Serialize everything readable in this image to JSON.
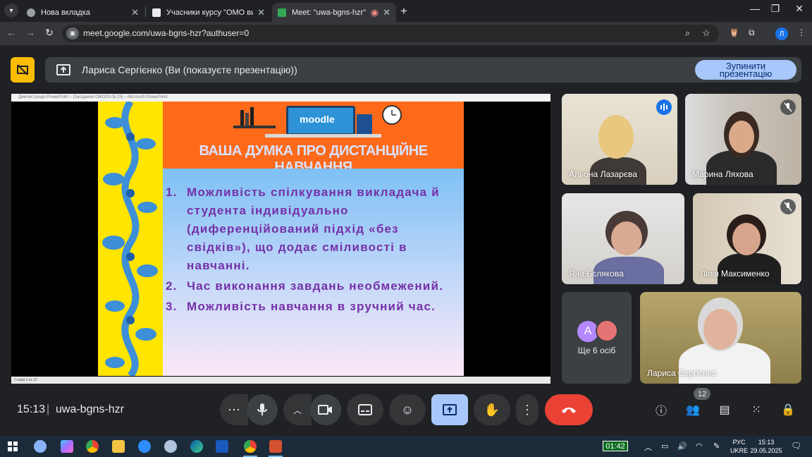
{
  "browser": {
    "tabs": [
      {
        "title": "Нова вкладка",
        "active": false
      },
      {
        "title": "Учасники курсу \"ОМО виклад",
        "active": false
      },
      {
        "title": "Meet: \"uwa-bgns-hzr\"",
        "active": true
      }
    ],
    "url": "meet.google.com/uwa-bgns-hzr?authuser=0",
    "profile_initial": "Л"
  },
  "banner": {
    "text": "Лариса Сергієнко (Ви (показуєте презентацію))",
    "stop_button": [
      "Зупинити",
      "презентацію"
    ]
  },
  "presentation": {
    "window_title": "Демонстрація PowerPoint – [Засідання ОМО29.05.25] – Microsoft PowerPoint",
    "status": "Слайд 3 из 12",
    "logo_text": "moodle",
    "heading": "ВАША ДУМКА ПРО ДИСТАНЦІЙНЕ НАВЧАННЯ",
    "items": [
      {
        "num": "1.",
        "text": "Можливість спілкування викладача й студента індивідуально (диференційований підхід «без свідків»), що додає сміливості в навчанні."
      },
      {
        "num": "2.",
        "text": "Час виконання завдань необмежений."
      },
      {
        "num": "3.",
        "text": "Можливість навчання в зручний час."
      }
    ]
  },
  "participants": [
    {
      "name": "Альона Лазарєва",
      "status": "speaking"
    },
    {
      "name": "Марина Ляхова",
      "status": "muted"
    },
    {
      "name": "Яна Бєлякова",
      "status": ""
    },
    {
      "name": "Лілія Максименко",
      "status": "muted"
    },
    {
      "name": "Лариса Сергієнко",
      "status": ""
    }
  ],
  "others": {
    "avatar_initial": "A",
    "label": "Ще 6 осіб"
  },
  "bottom_bar": {
    "time": "15:13",
    "separator": "|",
    "meeting_code": "uwa-bgns-hzr",
    "participant_count": "12"
  },
  "taskbar": {
    "timer": "01:42",
    "language_top": "РУС",
    "language_bottom": "UKRE",
    "clock_time": "15:13",
    "clock_date": "29.05.2025"
  },
  "colors": {
    "accent": "#a8c7fa",
    "end_call": "#ea4335",
    "present_warning": "#fbbc04"
  }
}
